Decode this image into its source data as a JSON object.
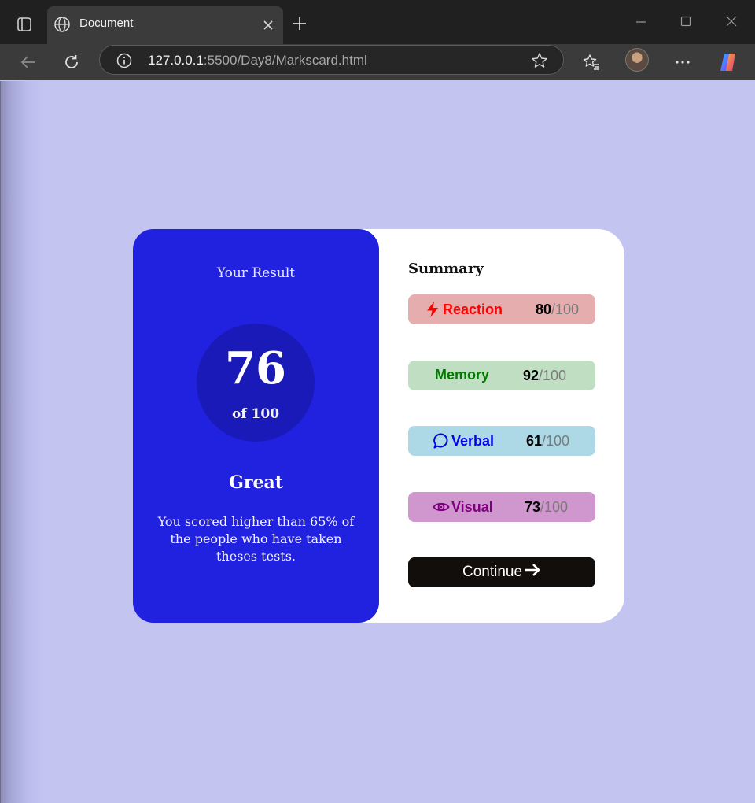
{
  "browser": {
    "tab_title": "Document",
    "url_host": "127.0.0.1",
    "url_path": ":5500/Day8/Markscard.html"
  },
  "result": {
    "label": "Your Result",
    "score": "76",
    "out_of": "of 100",
    "rating": "Great",
    "description": "You scored higher than 65% of the people who have taken theses tests."
  },
  "summary": {
    "title": "Summary",
    "items": [
      {
        "label": "Reaction",
        "score": "80",
        "max": "/100",
        "icon": "lightning-icon",
        "bg": "#e5adad",
        "color": "#ff0000"
      },
      {
        "label": "Memory",
        "score": "92",
        "max": "/100",
        "icon": "none",
        "bg": "#c0dfc2",
        "color": "#007a00"
      },
      {
        "label": "Verbal",
        "score": "61",
        "max": "/100",
        "icon": "speech-bubble-icon",
        "bg": "#add8e5",
        "color": "#0000ee"
      },
      {
        "label": "Visual",
        "score": "73",
        "max": "/100",
        "icon": "eye-icon",
        "bg": "#cf97cd",
        "color": "#800080"
      }
    ],
    "continue_label": "Continue"
  },
  "colors": {
    "page_bg": "#c3c4f0",
    "result_panel": "#2121e0",
    "score_circle": "#1a1ab8",
    "button": "#110e0c"
  }
}
